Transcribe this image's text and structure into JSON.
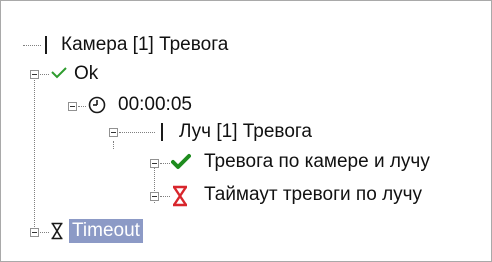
{
  "tree": {
    "root": {
      "label": "Камера [1] Тревога"
    },
    "condition_ok": {
      "label": "Ok",
      "icon": "check-mark-icon",
      "icon_color": "#2e9c2e"
    },
    "timer": {
      "label": "00:00:05",
      "icon": "clock-icon"
    },
    "beam_alarm": {
      "label": "Луч [1] Тревога"
    },
    "action_alarm": {
      "label": "Тревога по камере и лучу",
      "icon": "bold-check-icon",
      "icon_color": "#1e8c1e"
    },
    "action_timeout": {
      "label": "Таймаут тревоги по лучу",
      "icon": "hourglass-icon",
      "icon_color": "#d8262c"
    },
    "timeout": {
      "label": "Timeout",
      "icon": "hourglass-icon",
      "selected": true,
      "highlight_color": "#8c9ac6"
    }
  }
}
